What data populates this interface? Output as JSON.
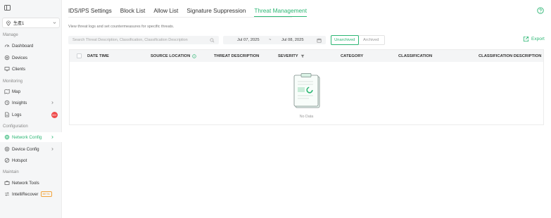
{
  "sidebar": {
    "site_name": "生產1",
    "sections": [
      {
        "label": "Manage",
        "items": [
          {
            "label": "Dashboard"
          },
          {
            "label": "Devices"
          },
          {
            "label": "Clients"
          }
        ]
      },
      {
        "label": "Monitoring",
        "items": [
          {
            "label": "Map"
          },
          {
            "label": "Insights"
          },
          {
            "label": "Logs",
            "badge": "99+"
          }
        ]
      },
      {
        "label": "Configuration",
        "items": [
          {
            "label": "Network Config"
          },
          {
            "label": "Device Config"
          },
          {
            "label": "Hotspot"
          }
        ]
      },
      {
        "label": "Maintain",
        "items": [
          {
            "label": "Network Tools"
          },
          {
            "label": "IntelliRecover",
            "tag": "BETA"
          }
        ]
      }
    ]
  },
  "tabs": [
    {
      "label": "IDS/IPS Settings"
    },
    {
      "label": "Block List"
    },
    {
      "label": "Allow List"
    },
    {
      "label": "Signature Suppression"
    },
    {
      "label": "Threat Management"
    }
  ],
  "page": {
    "description": "View threat logs and set countermeasures for specific threats.",
    "search_placeholder": "Search Threat Description, Classification, Classification Description",
    "date_start": "Jul 07, 2025",
    "date_sep": "~",
    "date_end": "Jul 08, 2025",
    "filter_unarchived": "Unarchived",
    "filter_archived": "Archived",
    "export_label": "Export"
  },
  "table": {
    "columns": [
      "DATE TIME",
      "SOURCE LOCATION",
      "THREAT DESCRIPTION",
      "SEVERITY",
      "CATEGORY",
      "CLASSIFICATION",
      "CLASSIFICATION DESCRIPTION"
    ],
    "empty_text": "No Data"
  },
  "colors": {
    "accent": "#2bb673",
    "badge": "#ef4b4b",
    "beta": "#f2a33a"
  }
}
